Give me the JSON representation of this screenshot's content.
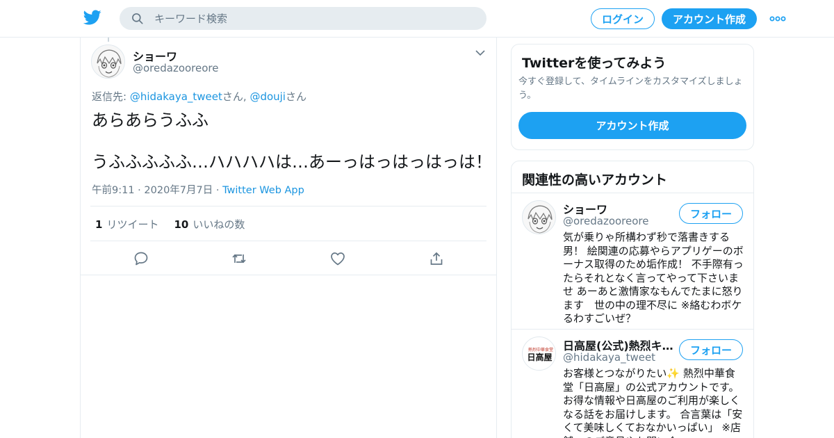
{
  "header": {
    "search_placeholder": "キーワード検索",
    "login_label": "ログイン",
    "signup_label": "アカウント作成"
  },
  "tweet": {
    "author_name": "ショーワ",
    "author_handle": "@oredazooreore",
    "reply_prefix": "返信先: ",
    "reply_mention_1": "@hidakaya_tweet",
    "reply_suffix_1": "さん, ",
    "reply_mention_2": "@douji",
    "reply_suffix_2": "さん",
    "text": "あらあらうふふ\n\nうふふふふふ…ハハハハは…あーっはっはっはっは！",
    "time": "午前9:11",
    "date": "2020年7月7日",
    "source": "Twitter Web App",
    "retweet_count": "1",
    "retweet_label": "リツイート",
    "like_count": "10",
    "like_label": "いいねの数"
  },
  "signup_card": {
    "title": "Twitterを使ってみよう",
    "description": "今すぐ登録して、タイムラインをカスタマイズしましょう。",
    "button_label": "アカウント作成"
  },
  "related": {
    "title": "関連性の高いアカウント",
    "accounts": [
      {
        "name": "ショーワ",
        "handle": "@oredazooreore",
        "follow_label": "フォロー",
        "bio": "気が乗りゃ所構わず秒で落書きする男！ 絵関連の応募やらアプリゲーのボーナス取得のため垢作成！ 不手際有ったらそれとなく言ってやって下さいませ あーあと激情家なもんでたまに怒ります　世の中の理不尽に ※絡むわボケるわすごいぜ？"
      },
      {
        "name": "日高屋(公式)熱烈キャ…",
        "handle": "@hidakaya_tweet",
        "follow_label": "フォロー",
        "avatar_text": "日高屋",
        "bio": "お客様とつながりたい✨ 熱烈中華食堂「日高屋」の公式アカウントです。お得な情報や日高屋のご利用が楽しくなる話をお届けします。 合言葉は「安くて美味しくておなかいっぱい」 ※店舗へのご意見やお問い合"
      }
    ]
  },
  "colors": {
    "accent": "#1da1f2",
    "link": "#1b95e0",
    "muted": "#657786",
    "border": "#e6ecf0"
  }
}
